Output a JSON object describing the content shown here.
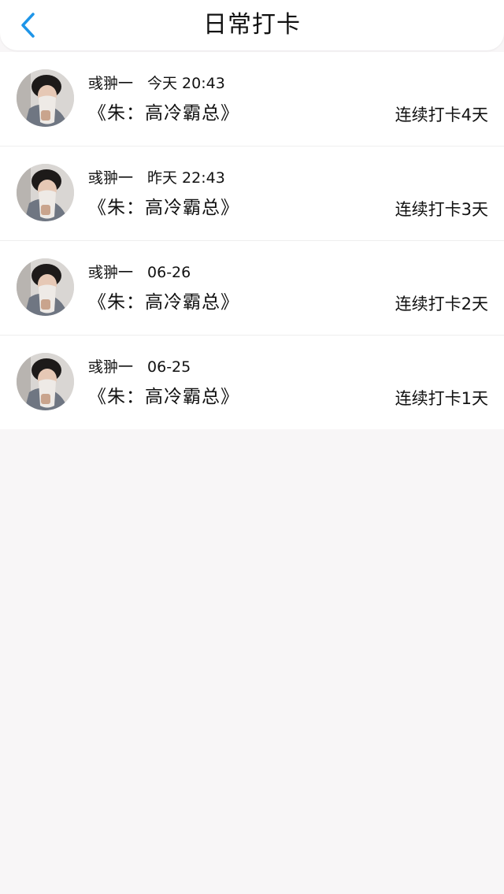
{
  "header": {
    "title": "日常打卡"
  },
  "checkins": [
    {
      "user": "彧翀一",
      "time": "今天 20:43",
      "book": "《朱：高冷霸总》",
      "streak": "连续打卡4天"
    },
    {
      "user": "彧翀一",
      "time": "昨天 22:43",
      "book": "《朱：高冷霸总》",
      "streak": "连续打卡3天"
    },
    {
      "user": "彧翀一",
      "time": "06-26",
      "book": "《朱：高冷霸总》",
      "streak": "连续打卡2天"
    },
    {
      "user": "彧翀一",
      "time": "06-25",
      "book": "《朱：高冷霸总》",
      "streak": "连续打卡1天"
    }
  ],
  "colors": {
    "accent": "#1e95e8",
    "background": "#f8f6f7"
  },
  "icons": {
    "back": "chevron-left-icon",
    "avatar": "user-avatar-photo"
  }
}
